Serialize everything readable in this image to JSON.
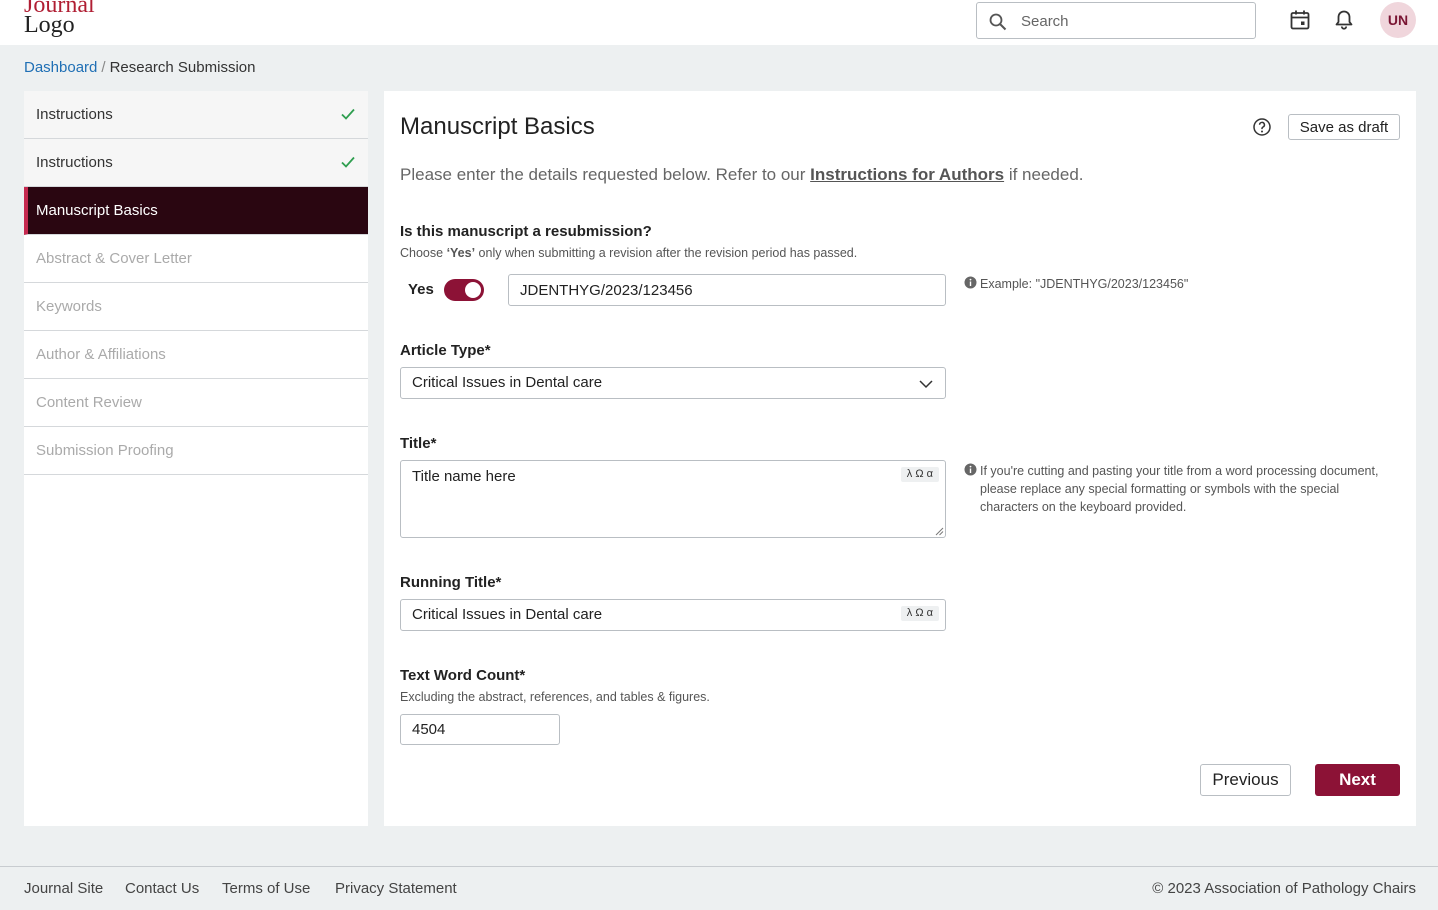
{
  "header": {
    "logo_line1": "Journal",
    "logo_line2": "Logo",
    "search_placeholder": "Search",
    "avatar_initials": "UN",
    "icons": [
      "search-icon",
      "calendar-icon",
      "bell-icon"
    ]
  },
  "breadcrumb": {
    "home": "Dashboard",
    "separator": "/",
    "current": "Research Submission"
  },
  "sidebar": {
    "items": [
      {
        "label": "Instructions",
        "state": "done"
      },
      {
        "label": "Instructions",
        "state": "done"
      },
      {
        "label": "Manuscript Basics",
        "state": "active"
      },
      {
        "label": "Abstract & Cover Letter",
        "state": "pending"
      },
      {
        "label": "Keywords",
        "state": "pending"
      },
      {
        "label": "Author & Affiliations",
        "state": "pending"
      },
      {
        "label": "Content Review",
        "state": "pending"
      },
      {
        "label": "Submission Proofing",
        "state": "pending"
      }
    ]
  },
  "main": {
    "title": "Manuscript Basics",
    "save_draft_label": "Save as draft",
    "intro_prefix": "Please enter the details requested below. Refer to our ",
    "intro_link": "Instructions for Authors",
    "intro_suffix": " if needed.",
    "resubmission": {
      "label": "Is this manuscript a resubmission?",
      "sub_prefix": "Choose ",
      "sub_emph": "‘Yes’",
      "sub_suffix": " only when submitting a revision after the revision period has passed.",
      "toggle_label": "Yes",
      "toggle_on": true,
      "value": "JDENTHYG/2023/123456",
      "hint": "Example: \"JDENTHYG/2023/123456\""
    },
    "article_type": {
      "label": "Article Type*",
      "selected": "Critical Issues in Dental care"
    },
    "title_field": {
      "label": "Title*",
      "value": "Title name here",
      "symbols": "λ Ω α",
      "hint": "If you're cutting and pasting your title from a word processing document, please replace any special formatting or symbols with the special characters on the keyboard provided."
    },
    "running_title": {
      "label": "Running Title*",
      "value": "Critical Issues in Dental care",
      "symbols": "λ Ω α"
    },
    "word_count": {
      "label": "Text Word Count*",
      "sub": "Excluding the abstract, references, and tables & figures.",
      "value": "4504"
    },
    "previous_label": "Previous",
    "next_label": "Next"
  },
  "footer": {
    "links": [
      "Journal Site",
      "Contact Us",
      "Terms of Use",
      "Privacy Statement"
    ],
    "copyright": "© 2023 Association of Pathology Chairs"
  },
  "colors": {
    "brand": "#8c1236",
    "active_nav_bg": "#2a0611",
    "link": "#1f6fb5",
    "check": "#2e9e4f"
  }
}
